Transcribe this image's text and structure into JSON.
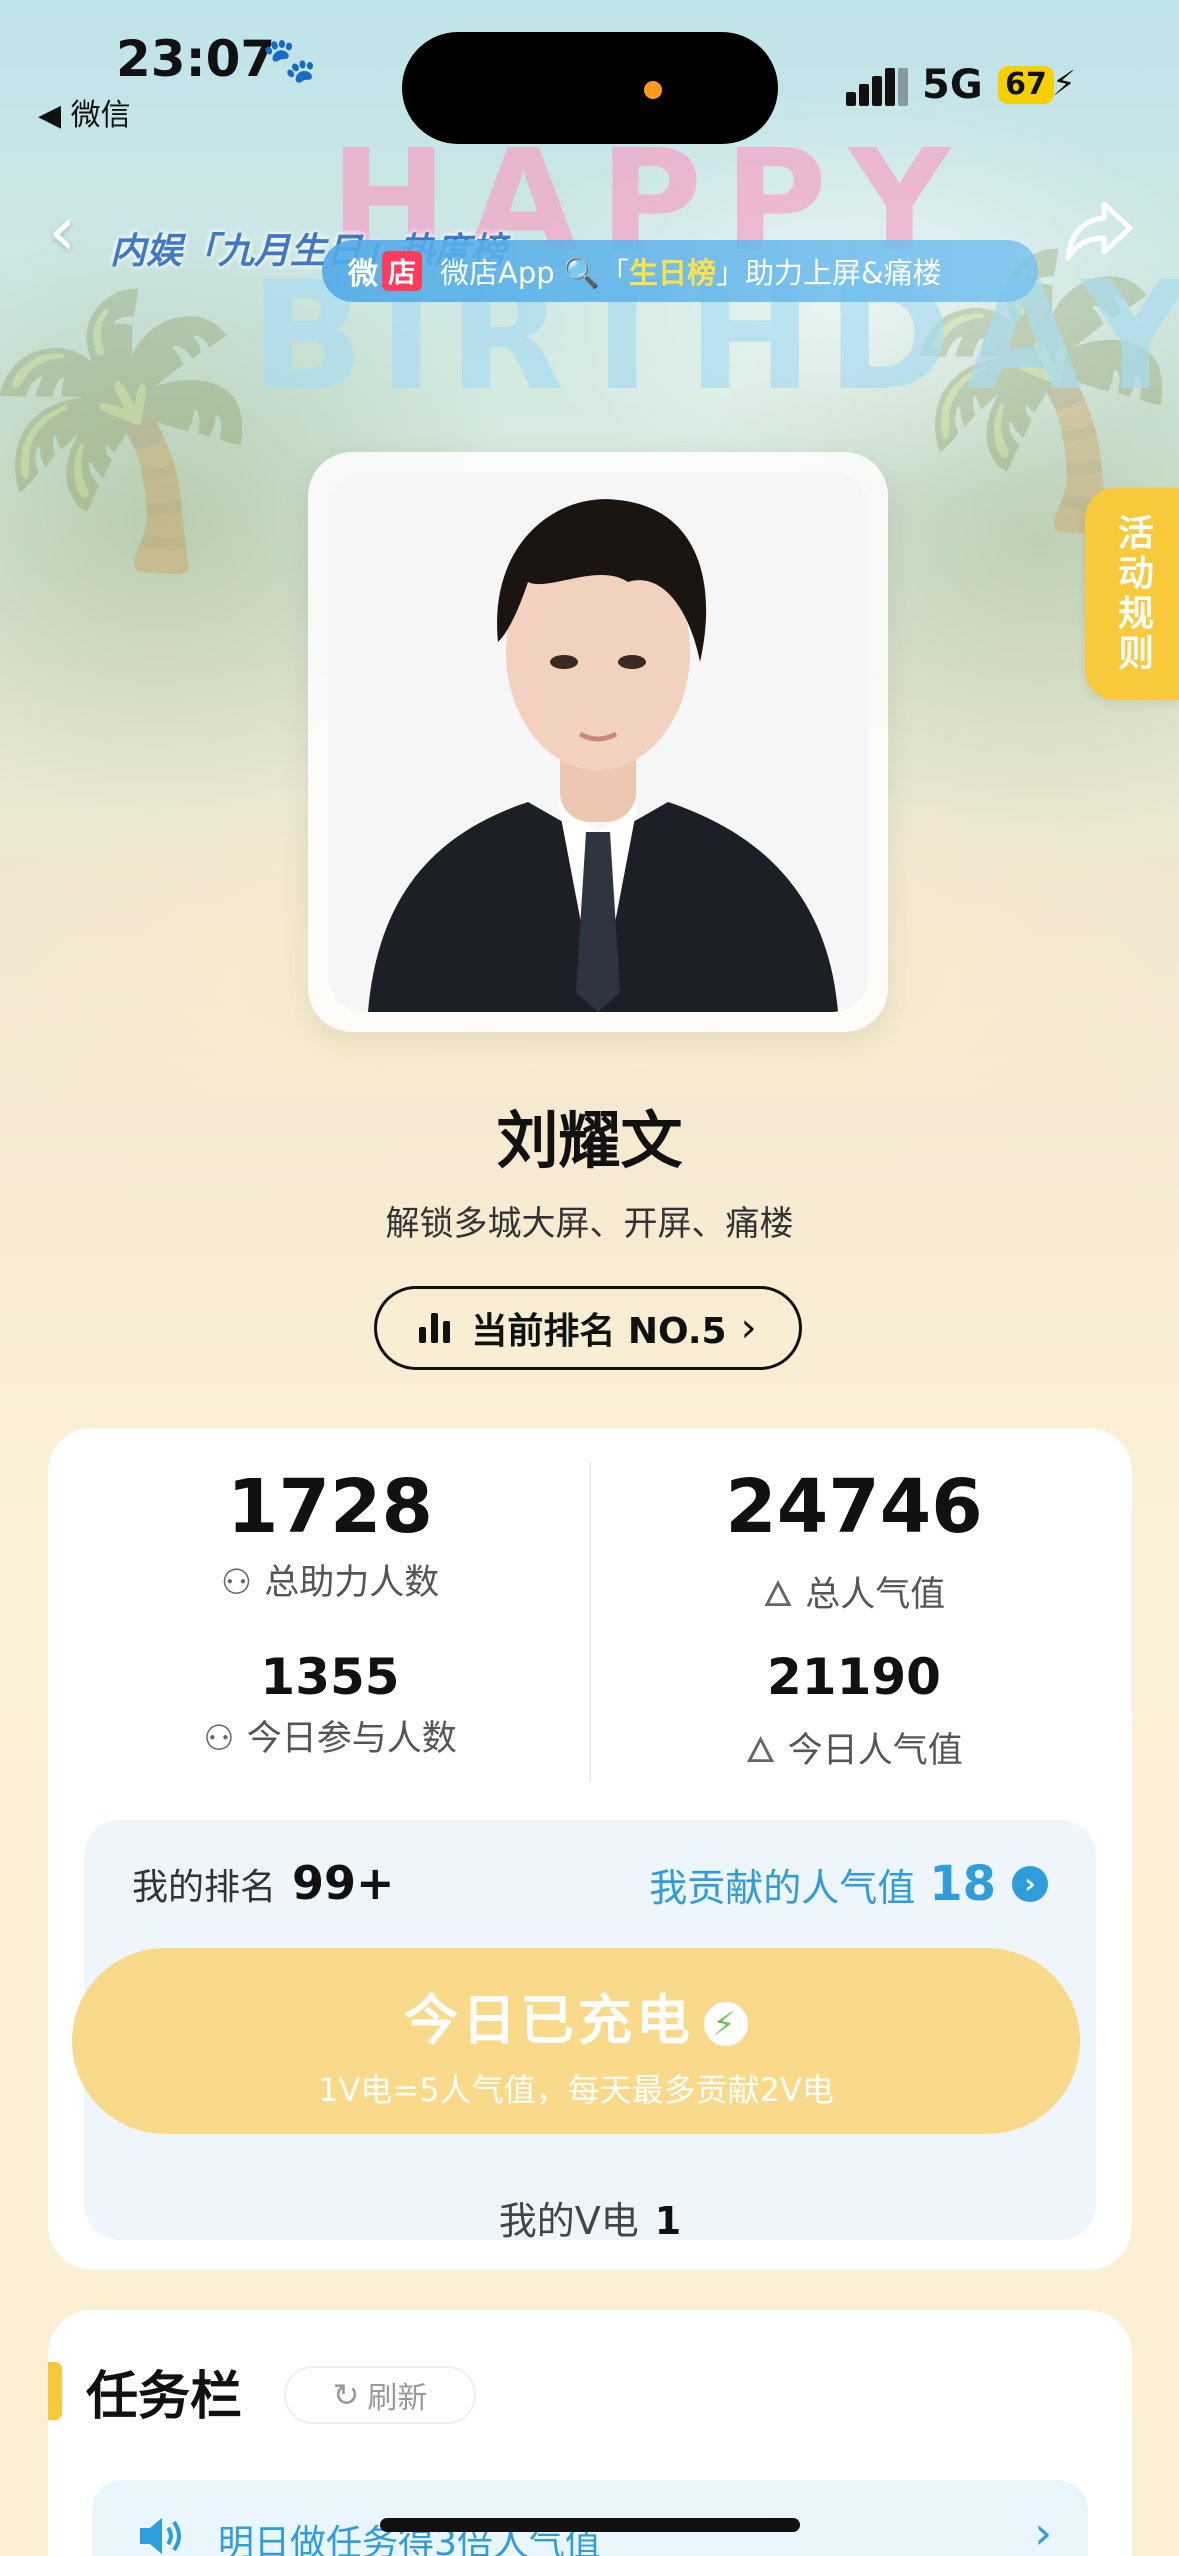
{
  "status_bar": {
    "time": "23:07",
    "back_to_app": "◀ 微信",
    "network": "5G",
    "battery": "67"
  },
  "header": {
    "logo_text": "内娱「九月生日」热度榜",
    "happy": "HAPPY",
    "birthday": "BIRTHDAY",
    "banner": {
      "tag_prefix": "微",
      "tag_badge": "店",
      "text_before": "微店App 🔍「",
      "highlight": "生日榜",
      "text_after": "」助力上屏&痛楼"
    }
  },
  "rules_tab_label": "活动规则",
  "star": {
    "name": "刘耀文",
    "subtitle": "解锁多城大屏、开屏、痛楼",
    "rank_label": "当前排名 NO.5"
  },
  "stats": {
    "total_helpers": {
      "value": "1728",
      "label": "总助力人数"
    },
    "total_popularity": {
      "value": "24746",
      "label": "总人气值"
    },
    "today_participants": {
      "value": "1355",
      "label": "今日参与人数"
    },
    "today_popularity": {
      "value": "21190",
      "label": "今日人气值"
    }
  },
  "my": {
    "rank_label": "我的排名",
    "rank_value": "99+",
    "contrib_label": "我贡献的人气值",
    "contrib_value": "18",
    "charge_title": "今日已充电",
    "charge_sub": "1V电=5人气值，每天最多贡献2V电",
    "v_power_label": "我的V电",
    "v_power_value": "1"
  },
  "tasks": {
    "title": "任务栏",
    "refresh_label": "刷新",
    "row_text": "明日做任务得3倍人气值"
  },
  "colors": {
    "accent_blue": "#2e9ddc",
    "accent_yellow": "#f8c93a",
    "charge_button": "#f8da8a"
  }
}
